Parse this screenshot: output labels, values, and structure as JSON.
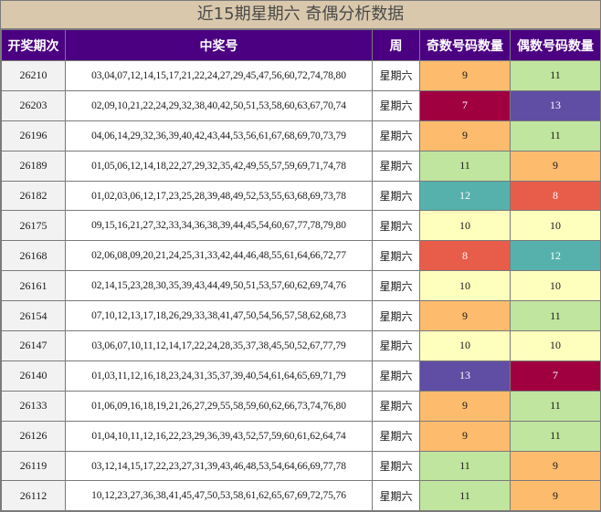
{
  "title": "近15期星期六 奇偶分析数据",
  "headers": [
    "开奖期次",
    "中奖号",
    "周",
    "奇数号码数量",
    "偶数号码数量"
  ],
  "colors": {
    "7": "#a00040",
    "8": "#e85c4a",
    "9": "#fdbb6d",
    "10": "#fefebd",
    "11": "#c0e59e",
    "12": "#56b1ac",
    "13": "#5f4ea3"
  },
  "rows": [
    {
      "period": "26210",
      "numbers": "03,04,07,12,14,15,17,21,22,24,27,29,45,47,56,60,72,74,78,80",
      "week": "星期六",
      "odd": "9",
      "even": "11"
    },
    {
      "period": "26203",
      "numbers": "02,09,10,21,22,24,29,32,38,40,42,50,51,53,58,60,63,67,70,74",
      "week": "星期六",
      "odd": "7",
      "even": "13"
    },
    {
      "period": "26196",
      "numbers": "04,06,14,29,32,36,39,40,42,43,44,53,56,61,67,68,69,70,73,79",
      "week": "星期六",
      "odd": "9",
      "even": "11"
    },
    {
      "period": "26189",
      "numbers": "01,05,06,12,14,18,22,27,29,32,35,42,49,55,57,59,69,71,74,78",
      "week": "星期六",
      "odd": "11",
      "even": "9"
    },
    {
      "period": "26182",
      "numbers": "01,02,03,06,12,17,23,25,28,39,48,49,52,53,55,63,68,69,73,78",
      "week": "星期六",
      "odd": "12",
      "even": "8"
    },
    {
      "period": "26175",
      "numbers": "09,15,16,21,27,32,33,34,36,38,39,44,45,54,60,67,77,78,79,80",
      "week": "星期六",
      "odd": "10",
      "even": "10"
    },
    {
      "period": "26168",
      "numbers": "02,06,08,09,20,21,24,25,31,33,42,44,46,48,55,61,64,66,72,77",
      "week": "星期六",
      "odd": "8",
      "even": "12"
    },
    {
      "period": "26161",
      "numbers": "02,14,15,23,28,30,35,39,43,44,49,50,51,53,57,60,62,69,74,76",
      "week": "星期六",
      "odd": "10",
      "even": "10"
    },
    {
      "period": "26154",
      "numbers": "07,10,12,13,17,18,26,29,33,38,41,47,50,54,56,57,58,62,68,73",
      "week": "星期六",
      "odd": "9",
      "even": "11"
    },
    {
      "period": "26147",
      "numbers": "03,06,07,10,11,12,14,17,22,24,28,35,37,38,45,50,52,67,77,79",
      "week": "星期六",
      "odd": "10",
      "even": "10"
    },
    {
      "period": "26140",
      "numbers": "01,03,11,12,16,18,23,24,31,35,37,39,40,54,61,64,65,69,71,79",
      "week": "星期六",
      "odd": "13",
      "even": "7"
    },
    {
      "period": "26133",
      "numbers": "01,06,09,16,18,19,21,26,27,29,55,58,59,60,62,66,73,74,76,80",
      "week": "星期六",
      "odd": "9",
      "even": "11"
    },
    {
      "period": "26126",
      "numbers": "01,04,10,11,12,16,22,23,29,36,39,43,52,57,59,60,61,62,64,74",
      "week": "星期六",
      "odd": "9",
      "even": "11"
    },
    {
      "period": "26119",
      "numbers": "03,12,14,15,17,22,23,27,31,39,43,46,48,53,54,64,66,69,77,78",
      "week": "星期六",
      "odd": "11",
      "even": "9"
    },
    {
      "period": "26112",
      "numbers": "10,12,23,27,36,38,41,45,47,50,53,58,61,62,65,67,69,72,75,76",
      "week": "星期六",
      "odd": "11",
      "even": "9"
    }
  ]
}
